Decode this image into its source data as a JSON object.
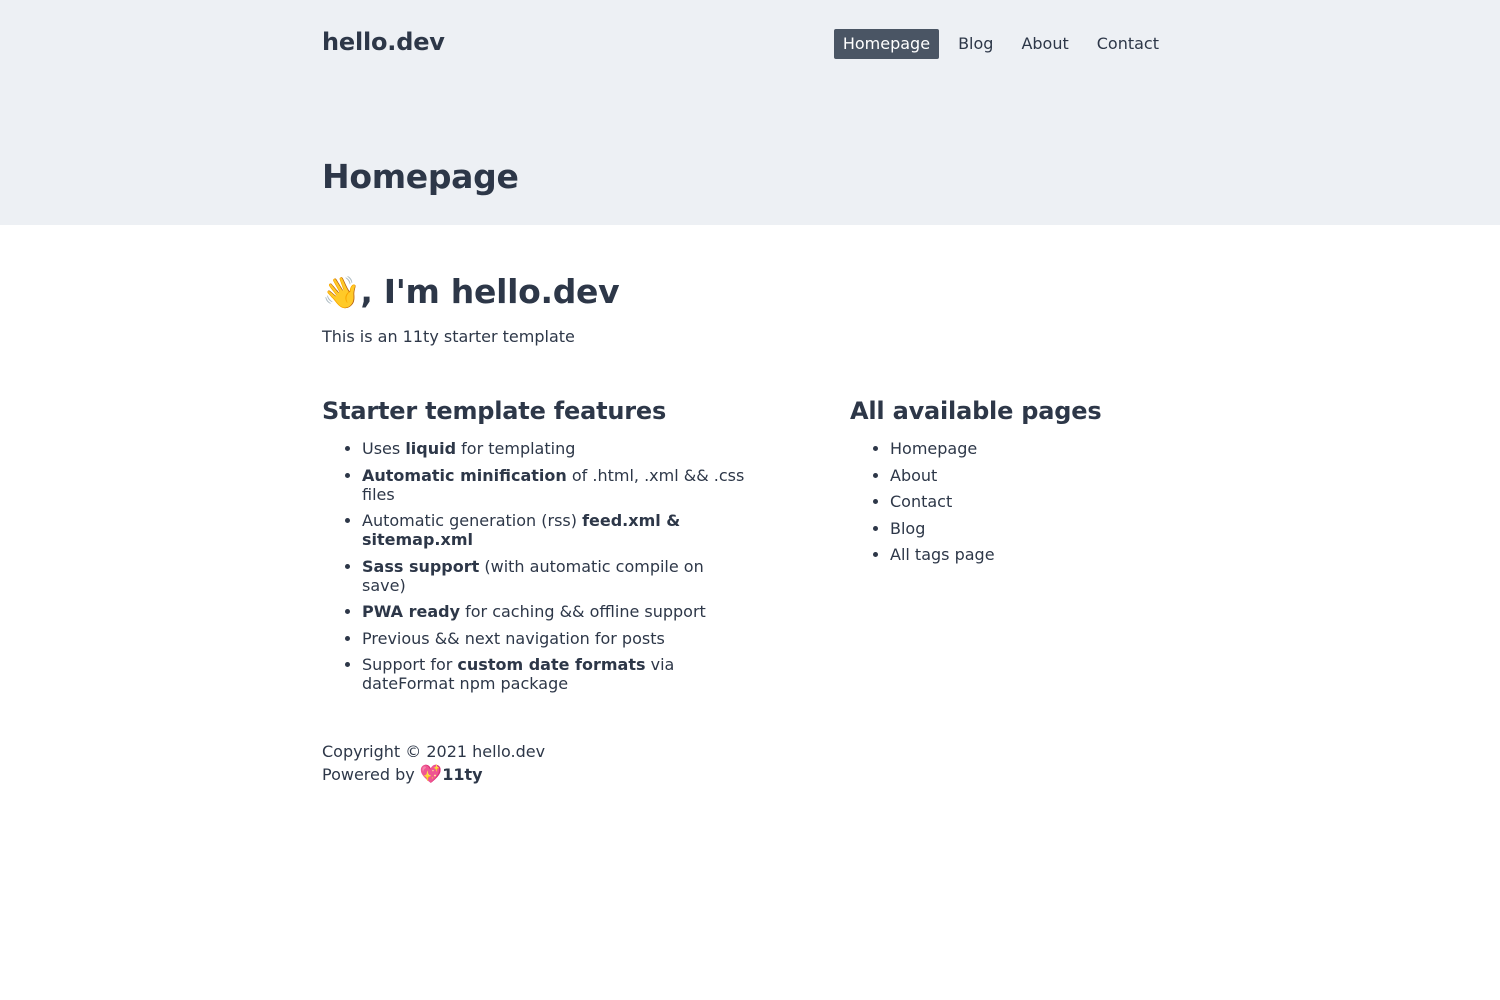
{
  "site": {
    "logo": "hello.dev"
  },
  "nav": {
    "items": [
      {
        "label": "Homepage",
        "active": true
      },
      {
        "label": "Blog",
        "active": false
      },
      {
        "label": "About",
        "active": false
      },
      {
        "label": "Contact",
        "active": false
      }
    ]
  },
  "page": {
    "title": "Homepage"
  },
  "intro": {
    "wave_icon": "👋",
    "heading": ", I'm hello.dev",
    "text": "This is an 11ty starter template"
  },
  "features": {
    "heading": "Starter template features",
    "items": [
      {
        "pre": "Uses ",
        "bold": "liquid",
        "post": " for templating"
      },
      {
        "pre": "",
        "bold": "Automatic minification",
        "post": " of .html, .xml && .css files"
      },
      {
        "pre": "Automatic generation (rss) ",
        "bold": "feed.xml & sitemap.xml",
        "post": ""
      },
      {
        "pre": "",
        "bold": "Sass support",
        "post": " (with automatic compile on save)"
      },
      {
        "pre": "",
        "bold": "PWA ready",
        "post": " for caching && offline support"
      },
      {
        "pre": "Previous && next navigation for posts",
        "bold": "",
        "post": ""
      },
      {
        "pre": "Support for ",
        "bold": "custom date formats",
        "post": " via dateFormat npm package"
      }
    ]
  },
  "pages": {
    "heading": "All available pages",
    "items": [
      "Homepage",
      "About",
      "Contact",
      "Blog",
      "All tags page"
    ]
  },
  "footer": {
    "copyright": "Copyright © 2021 hello.dev",
    "powered_by": "Powered by ",
    "heart_icon": "💖",
    "powered_link": "11ty"
  },
  "colors": {
    "header_bg": "#edf0f4",
    "text": "#2d3748",
    "nav_active_bg": "#4a5564",
    "nav_active_text": "#ffffff"
  }
}
